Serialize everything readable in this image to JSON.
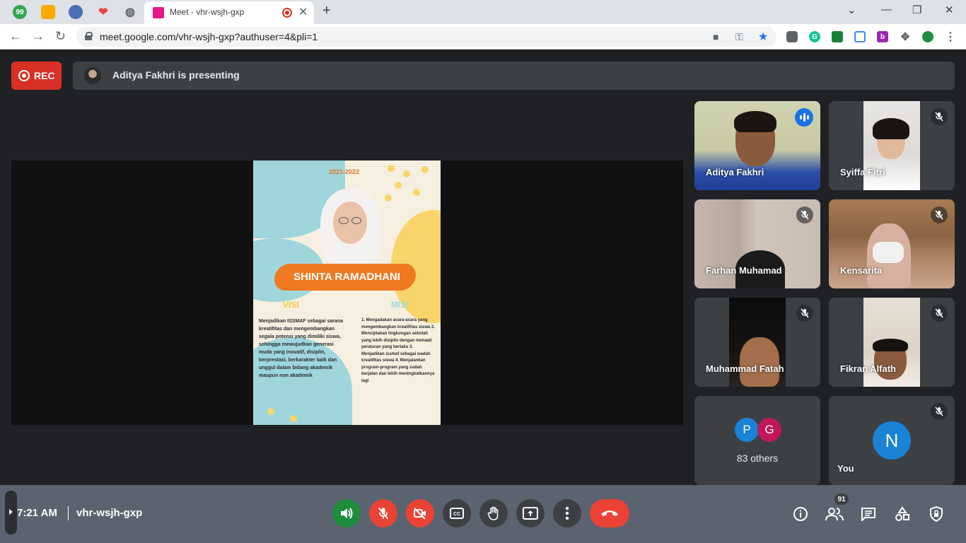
{
  "browser": {
    "tab_title": "Meet - vhr-wsjh-gxp",
    "pinned_tab_1_text": "99",
    "url": "meet.google.com/vhr-wsjh-gxp?authuser=4&pli=1",
    "ext_b_label": "b",
    "ext_g_label": "G"
  },
  "meet": {
    "rec_label": "REC",
    "presenting_text": "Aditya Fakhri is presenting",
    "participants": [
      {
        "name": "Aditya Fakhri"
      },
      {
        "name": "Syiffa Fitri"
      },
      {
        "name": "Farhan Muhamad"
      },
      {
        "name": "Kensarita"
      },
      {
        "name": "Muhammad Fatah"
      },
      {
        "name": "Fikran Alfath"
      }
    ],
    "others": {
      "initial_1": "P",
      "initial_2": "G",
      "label": "83 others"
    },
    "you": {
      "initial": "N",
      "label": "You"
    }
  },
  "poster": {
    "year": "2021-2022",
    "name": "SHINTA RAMADHANI",
    "visi_title": "VISI",
    "misi_title": "MISI",
    "visi_text": "Menjadikan ISSMAF sebagai sarana kreatifitas dan mengembangkan segala potensi yang dimiliki siswa, sehingga mewujudkan generasi muda yang inovatif, disiplin, berprestasi, berkarakter baik dan unggul dalam bidang akademik maupun non akademik",
    "misi_text": "1. Mengadakan acara-acara yang mengembangkan kreatifitas siswa 2. Menciptakan lingkungan sekolah yang lebih disiplin dengan menaati peraturan yang berlaku 3. Menjadikan issmaf sebagai wadah kreatifitas siswa 4. Menjalankan program-program yang sudah berjalan dan lebih meningkatkannya lagi"
  },
  "controls": {
    "time": "7:21 AM",
    "meeting_code": "vhr-wsjh-gxp",
    "people_count": "91"
  },
  "colors": {
    "rec_red": "#d93025",
    "active_outline": "#8ab4f8",
    "speaking_blue": "#1a73e8",
    "unmute_green": "#1e8e3e",
    "poster_orange": "#ef7a22"
  }
}
